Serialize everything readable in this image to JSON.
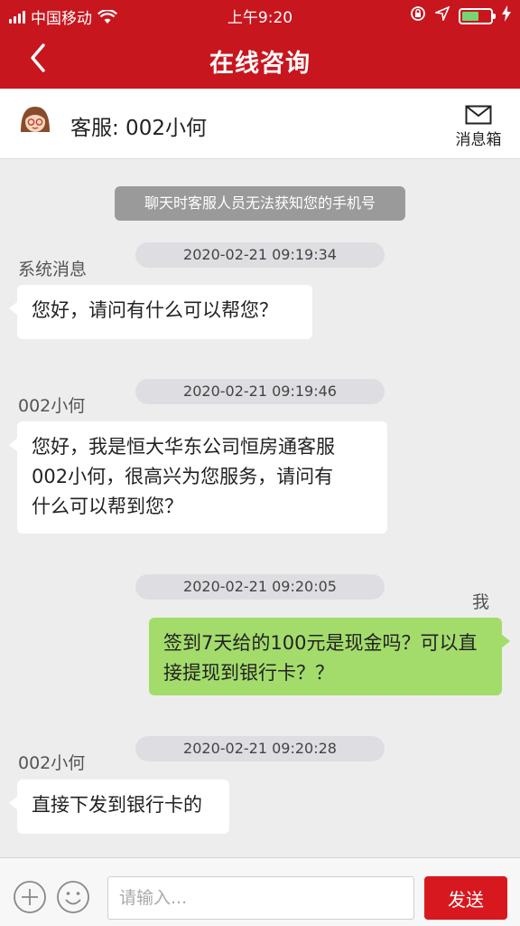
{
  "status": {
    "carrier": "中国移动",
    "time": "上午9:20"
  },
  "nav": {
    "title": "在线咨询"
  },
  "agent": {
    "name": "客服: 002小何",
    "inbox_label": "消息箱"
  },
  "chat": {
    "notice": "聊天时客服人员无法获知您的手机号",
    "messages": [
      {
        "timestamp": "2020-02-21 09:19:34",
        "sender": "系统消息",
        "text": "您好，请问有什么可以帮您？"
      },
      {
        "timestamp": "2020-02-21 09:19:46",
        "sender": "002小何",
        "text_lines": [
          "您好，我是恒大华东公司恒房通客服",
          "002小何，很高兴为您服务，请问有",
          "什么可以帮到您？"
        ]
      },
      {
        "timestamp": "2020-02-21 09:20:05",
        "sender": "我",
        "text_lines": [
          "签到7天给的100元是现金吗？可以直",
          "接提现到银行卡？？"
        ]
      },
      {
        "timestamp": "2020-02-21 09:20:28",
        "sender": "002小何",
        "text": "直接下发到银行卡的"
      }
    ]
  },
  "input": {
    "placeholder": "请输入...",
    "send_label": "发送"
  },
  "colors": {
    "header": "#c8161e",
    "outgoing_bubble": "#a4dc6c",
    "send_button": "#d7191f"
  }
}
